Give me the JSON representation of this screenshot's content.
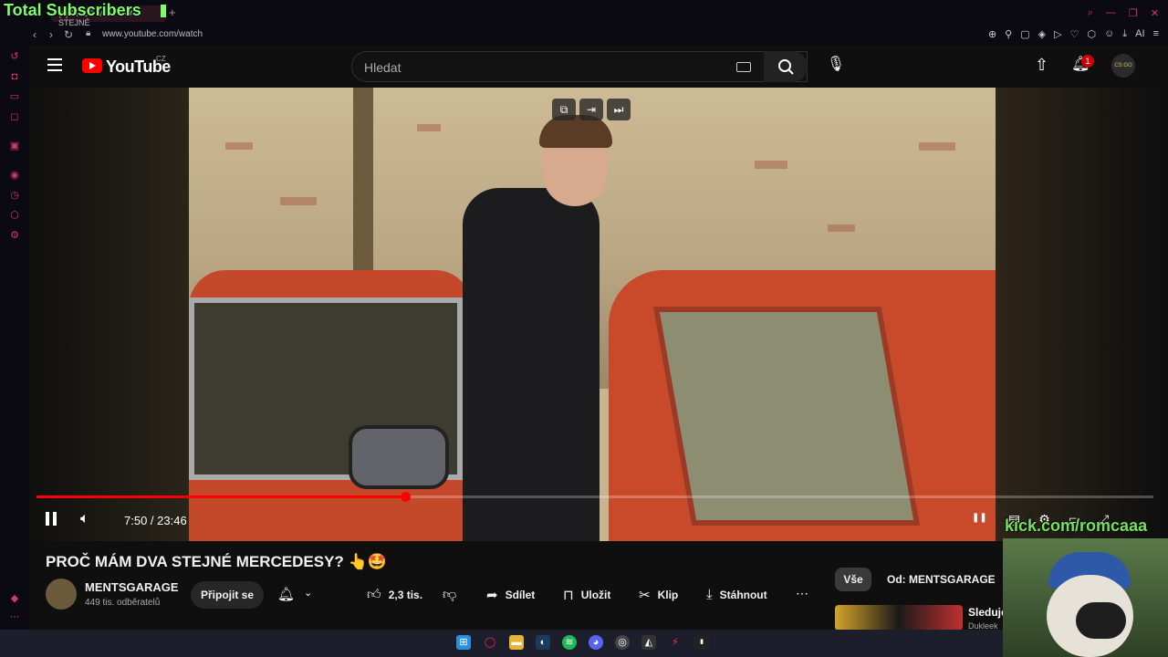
{
  "overlay": {
    "title": "Total Subscribers"
  },
  "browser": {
    "tab_title": "(1) PROČ MÁM DVA STEJNÉ",
    "new_tab": "+",
    "url": "www.youtube.com/watch",
    "ext_ai_label": "AI"
  },
  "youtube": {
    "wordmark": "YouTube",
    "country": "CZ",
    "search_placeholder": "Hledat",
    "notifications_count": "1",
    "avatar_text": "CS:GO"
  },
  "player": {
    "current_time": "7:50",
    "duration": "23:46",
    "time_display": "7:50 / 23:46",
    "progress_percent": 33
  },
  "video": {
    "title": "PROČ MÁM DVA STEJNÉ MERCEDESY? 👆🤩",
    "channel": "MENTSGARAGE",
    "subscribers": "449 tis. odběratelů",
    "join_label": "Připojit se",
    "likes": "2,3 tis.",
    "share": "Sdílet",
    "save": "Uložit",
    "clip": "Klip",
    "download": "Stáhnout"
  },
  "recommendations": {
    "chip_all": "Vše",
    "chip_from": "Od: MENTSGARAGE",
    "first_title": "Sleduje",
    "first_sub": "Dukleek"
  },
  "stream_overlay": {
    "kick_label": "kick.com/romcaaa"
  },
  "colors": {
    "accent": "#ff0000",
    "sidebar_icons": "#d33b5a",
    "overlay_green": "#7dff6a"
  }
}
